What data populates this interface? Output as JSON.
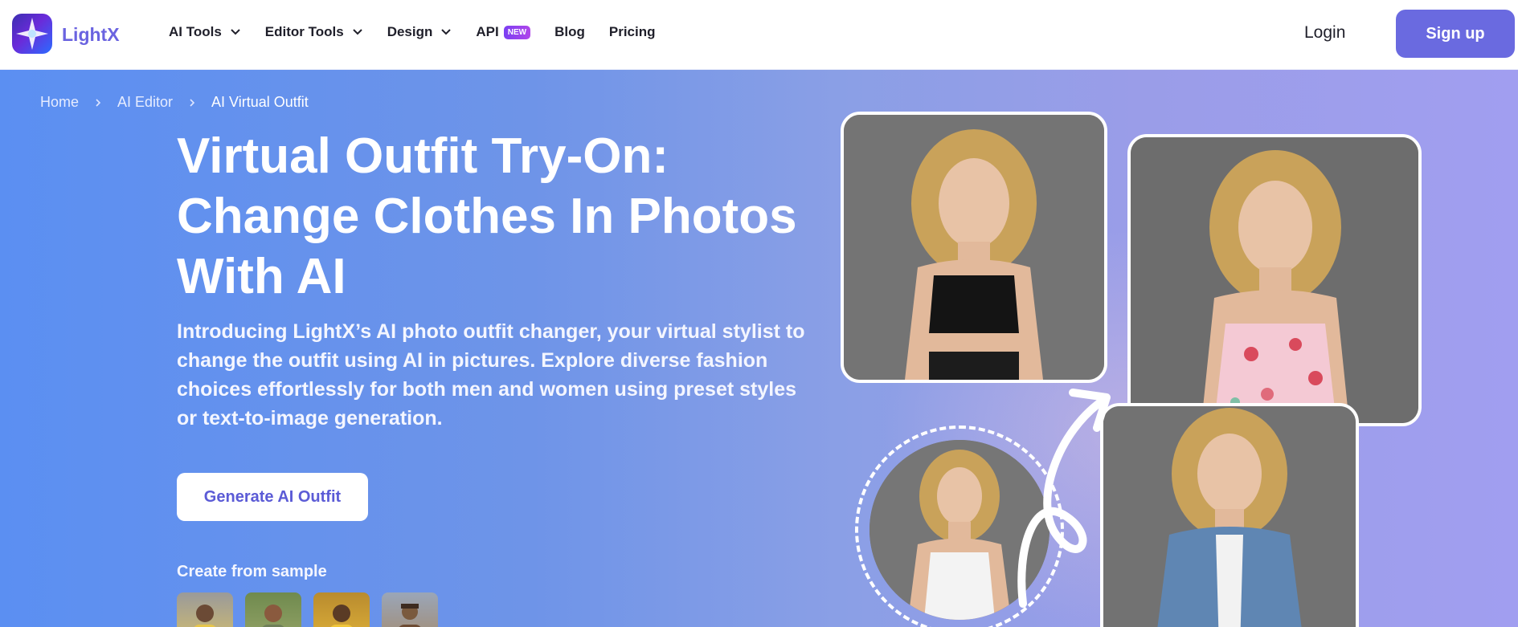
{
  "header": {
    "brand": "LightX",
    "nav": [
      {
        "label": "AI Tools",
        "has_menu": true
      },
      {
        "label": "Editor Tools",
        "has_menu": true
      },
      {
        "label": "Design",
        "has_menu": true
      },
      {
        "label": "API",
        "badge": "NEW",
        "has_menu": false
      },
      {
        "label": "Blog",
        "has_menu": false
      },
      {
        "label": "Pricing",
        "has_menu": false
      }
    ],
    "login": "Login",
    "signup": "Sign up"
  },
  "breadcrumb": [
    "Home",
    "AI Editor",
    "AI Virtual Outfit"
  ],
  "hero": {
    "title": "Virtual Outfit Try-On: Change Clothes In Photos With AI",
    "description": "Introducing LightX’s AI photo outfit changer, your virtual stylist to change the outfit using AI in pictures. Explore diverse fashion choices effortlessly for both men and women using preset styles or text-to-image generation.",
    "cta": "Generate AI Outfit",
    "sample_label": "Create from sample"
  },
  "colors": {
    "accent": "#6a6ae0",
    "brand_text": "#6a63e0",
    "badge": "#8b3ff0"
  }
}
